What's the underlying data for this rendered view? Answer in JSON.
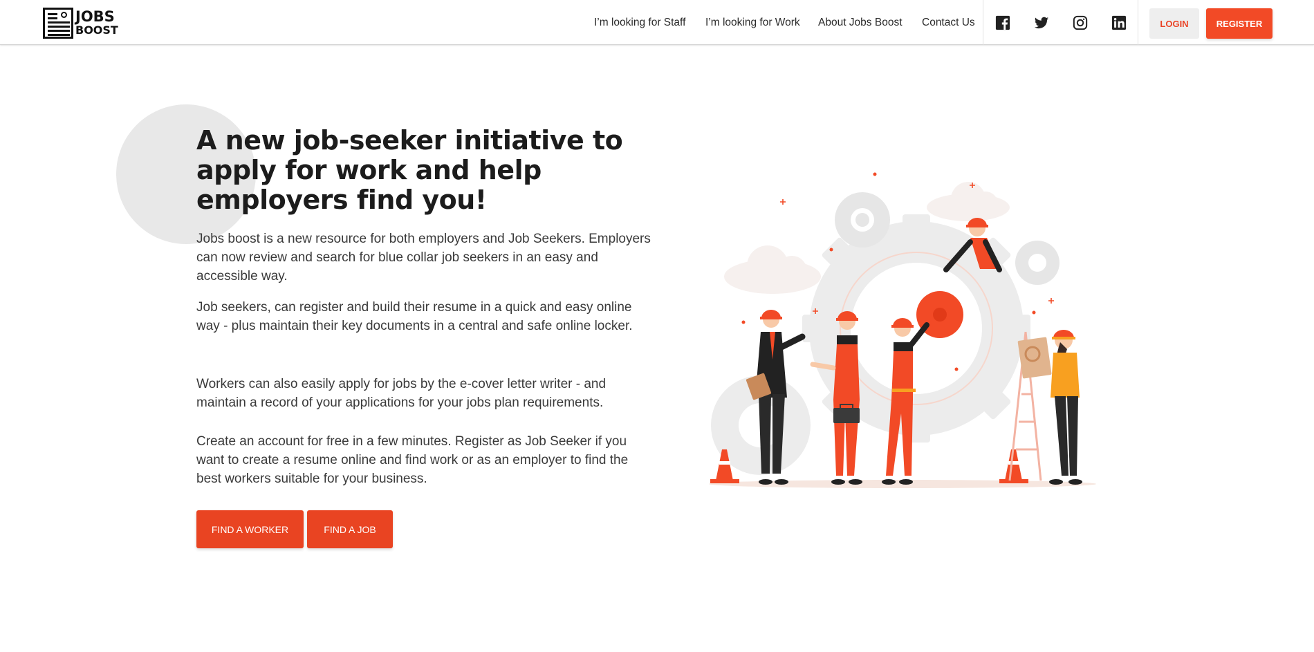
{
  "brand": {
    "line1": "JOBS",
    "line2": "BOOST"
  },
  "nav": {
    "items": [
      {
        "label": "I’m looking for Staff"
      },
      {
        "label": "I’m looking for Work"
      },
      {
        "label": "About Jobs Boost"
      },
      {
        "label": "Contact Us"
      }
    ],
    "social": [
      "facebook-icon",
      "twitter-icon",
      "instagram-icon",
      "linkedin-icon"
    ],
    "login_label": "LOGIN",
    "register_label": "REGISTER"
  },
  "hero": {
    "headline": "A new job-seeker initiative to apply for work and help employers find you!",
    "paragraphs": [
      "Jobs boost is a new resource for both employers and Job Seekers. Employers can now review and search for blue collar job seekers in an easy and accessible way.",
      "Job seekers, can register and build their resume in a quick and easy online way - plus maintain their key documents in a central and safe online locker.",
      "Workers can also easily apply for jobs by the e-cover letter writer - and maintain a record of your applications for your jobs plan requirements.",
      "Create an account for free in a few minutes. Register as Job Seeker if you want to create a resume online and find work or as an employer to find the best workers suitable for your business."
    ],
    "find_worker_label": "FIND A WORKER",
    "find_job_label": "FIND A JOB"
  },
  "colors": {
    "accent": "#f24a26",
    "accent_dark": "#e94422",
    "text": "#222222",
    "muted_bg": "#eeeeee"
  }
}
